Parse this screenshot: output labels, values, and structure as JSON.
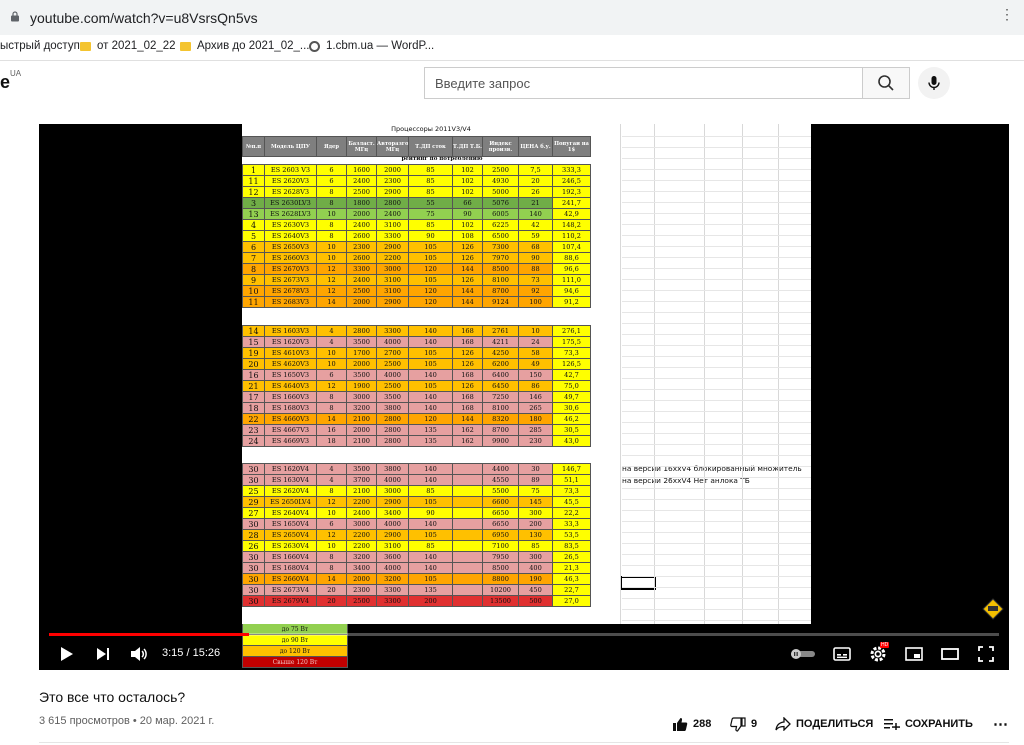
{
  "browser": {
    "url": "youtube.com/watch?v=u8VsrsQn5vs"
  },
  "bookmarks": [
    {
      "label": "ыстрый доступ",
      "icon": "none"
    },
    {
      "label": "от 2021_02_22",
      "icon": "folder-icon"
    },
    {
      "label": "Архив до 2021_02_...",
      "icon": "folder-icon"
    },
    {
      "label": "1.cbm.ua — WordP...",
      "icon": "globe-icon"
    }
  ],
  "header": {
    "logo_fragment": "e",
    "region": "UA",
    "search_placeholder": "Введите запрос"
  },
  "sheet": {
    "title": "Процессоры 2011V3/V4",
    "subhead": "рейтинг по потреблению",
    "headers": [
      "№п.п",
      "Модель ЦПУ",
      "Ядер",
      "Базласт. МГц",
      "Авторазгон МГц",
      "Т.ДП сток",
      "Т.ДП Т.Б.",
      "Индекс произв.",
      "ЦЕНА б.у.",
      "Попугаи на 1$"
    ],
    "rows_v3": [
      [
        "1",
        "ES 2603 V3",
        "6",
        "1600",
        "2000",
        "85",
        "102",
        "2500",
        "7,5",
        "333,3",
        "#ffff00"
      ],
      [
        "11",
        "ES 2620V3",
        "6",
        "2400",
        "2300",
        "85",
        "102",
        "4930",
        "20",
        "246,5",
        "#ffff00"
      ],
      [
        "12",
        "ES 2628V3",
        "8",
        "2500",
        "2900",
        "85",
        "102",
        "5000",
        "26",
        "192,3",
        "#ffff00"
      ],
      [
        "3",
        "ES 2630LV3",
        "8",
        "1800",
        "2800",
        "55",
        "66",
        "5076",
        "21",
        "241,7",
        "#70ad47"
      ],
      [
        "13",
        "ES 2628LV3",
        "10",
        "2000",
        "2400",
        "75",
        "90",
        "6005",
        "140",
        "42,9",
        "#92d050"
      ],
      [
        "4",
        "ES 2630V3",
        "8",
        "2400",
        "3100",
        "85",
        "102",
        "6225",
        "42",
        "148,2",
        "#ffff00"
      ],
      [
        "5",
        "ES 2640V3",
        "8",
        "2600",
        "3300",
        "90",
        "108",
        "6500",
        "59",
        "110,2",
        "#ffff00"
      ],
      [
        "6",
        "ES 2650V3",
        "10",
        "2300",
        "2900",
        "105",
        "126",
        "7300",
        "68",
        "107,4",
        "#ffc000"
      ],
      [
        "7",
        "ES 2660V3",
        "10",
        "2600",
        "2200",
        "105",
        "126",
        "7970",
        "90",
        "88,6",
        "#ffc000"
      ],
      [
        "8",
        "ES 2670V3",
        "12",
        "3300",
        "3000",
        "120",
        "144",
        "8500",
        "88",
        "96,6",
        "#ffa500"
      ],
      [
        "9",
        "ES 2673V3",
        "12",
        "2400",
        "3100",
        "105",
        "126",
        "8100",
        "73",
        "111,0",
        "#ffc000"
      ],
      [
        "10",
        "ES 2678V3",
        "12",
        "2500",
        "3100",
        "120",
        "144",
        "8700",
        "92",
        "94,6",
        "#ffa500"
      ],
      [
        "11",
        "ES 2683V3",
        "14",
        "2000",
        "2900",
        "120",
        "144",
        "9124",
        "100",
        "91,2",
        "#ffa500"
      ]
    ],
    "rows_v3_2": [
      [
        "14",
        "ES 1603V3",
        "4",
        "2800",
        "3300",
        "140",
        "168",
        "2761",
        "10",
        "276,1",
        "#ffc000"
      ],
      [
        "15",
        "ES 1620V3",
        "4",
        "3500",
        "4000",
        "140",
        "168",
        "4211",
        "24",
        "175,5",
        "#e6a0a0"
      ],
      [
        "19",
        "ES 4610V3",
        "10",
        "1700",
        "2700",
        "105",
        "126",
        "4250",
        "58",
        "73,3",
        "#ffc000"
      ],
      [
        "20",
        "ES 4620V3",
        "10",
        "2000",
        "2500",
        "105",
        "126",
        "6200",
        "49",
        "126,5",
        "#ffc000"
      ],
      [
        "16",
        "ES 1650V3",
        "6",
        "3500",
        "4000",
        "140",
        "168",
        "6400",
        "150",
        "42,7",
        "#e6a0a0"
      ],
      [
        "21",
        "ES 4640V3",
        "12",
        "1900",
        "2500",
        "105",
        "126",
        "6450",
        "86",
        "75,0",
        "#ffc000"
      ],
      [
        "17",
        "ES 1660V3",
        "8",
        "3000",
        "3500",
        "140",
        "168",
        "7250",
        "146",
        "49,7",
        "#e6a0a0"
      ],
      [
        "18",
        "ES 1680V3",
        "8",
        "3200",
        "3800",
        "140",
        "168",
        "8100",
        "265",
        "30,6",
        "#e6a0a0"
      ],
      [
        "22",
        "ES 4660V3",
        "14",
        "2100",
        "2800",
        "120",
        "144",
        "8320",
        "180",
        "46,2",
        "#ffa500"
      ],
      [
        "23",
        "ES 4667V3",
        "16",
        "2000",
        "2800",
        "135",
        "162",
        "8700",
        "285",
        "30,5",
        "#e6a0a0"
      ],
      [
        "24",
        "ES 4669V3",
        "18",
        "2100",
        "2800",
        "135",
        "162",
        "9900",
        "230",
        "43,0",
        "#e6a0a0"
      ]
    ],
    "rows_v4": [
      [
        "30",
        "ES 1620V4",
        "4",
        "3500",
        "3800",
        "140",
        "",
        "4400",
        "30",
        "146,7",
        "#e6a0a0"
      ],
      [
        "30",
        "ES 1630V4",
        "4",
        "3700",
        "4000",
        "140",
        "",
        "4550",
        "89",
        "51,1",
        "#e6a0a0"
      ],
      [
        "25",
        "ES 2620V4",
        "8",
        "2100",
        "3000",
        "85",
        "",
        "5500",
        "75",
        "73,3",
        "#ffff00"
      ],
      [
        "29",
        "ES 2650LV4",
        "12",
        "2200",
        "2900",
        "105",
        "",
        "6600",
        "145",
        "45,5",
        "#ffc000"
      ],
      [
        "27",
        "ES 2640V4",
        "10",
        "2400",
        "3400",
        "90",
        "",
        "6650",
        "300",
        "22,2",
        "#ffff00"
      ],
      [
        "30",
        "ES 1650V4",
        "6",
        "3000",
        "4000",
        "140",
        "",
        "6650",
        "200",
        "33,3",
        "#e6a0a0"
      ],
      [
        "28",
        "ES 2650V4",
        "12",
        "2200",
        "2900",
        "105",
        "",
        "6950",
        "130",
        "53,5",
        "#ffc000"
      ],
      [
        "26",
        "ES 2630V4",
        "10",
        "2200",
        "3100",
        "85",
        "",
        "7100",
        "85",
        "83,5",
        "#ffff00"
      ],
      [
        "30",
        "ES 1660V4",
        "8",
        "3200",
        "3600",
        "140",
        "",
        "7950",
        "300",
        "26,5",
        "#e6a0a0"
      ],
      [
        "30",
        "ES 1680V4",
        "8",
        "3400",
        "4000",
        "140",
        "",
        "8500",
        "400",
        "21,3",
        "#e6a0a0"
      ],
      [
        "30",
        "ES 2660V4",
        "14",
        "2000",
        "3200",
        "105",
        "",
        "8800",
        "190",
        "46,3",
        "#ffa500"
      ],
      [
        "30",
        "ES 2673V4",
        "20",
        "2300",
        "3300",
        "135",
        "",
        "10200",
        "450",
        "22,7",
        "#e6a0a0"
      ],
      [
        "30",
        "ES 2679V4",
        "20",
        "2500",
        "3300",
        "200",
        "",
        "13500",
        "500",
        "27,0",
        "#e03030"
      ]
    ],
    "notes": [
      "на версии 16xxV4 блокированный множитель",
      "на версии 26xxV4  Нет анлока ТБ"
    ],
    "legend": [
      {
        "label": "до 75 Вт",
        "color": "#92d050"
      },
      {
        "label": "до 90 Вт",
        "color": "#ffff00"
      },
      {
        "label": "до 120 Вт",
        "color": "#ffc000"
      },
      {
        "label": "Свыше 120 Вт",
        "color": "#c00000"
      }
    ]
  },
  "player": {
    "current_time": "3:15",
    "duration": "15:26",
    "time_display": "3:15 / 15:26",
    "progress": 0.21,
    "hd_badge": "HD"
  },
  "video": {
    "title": "Это все что осталось?",
    "meta": "3 615 просмотров • 20 мар. 2021 г.",
    "likes": "288",
    "dislikes": "9",
    "share_label": "ПОДЕЛИТЬСЯ",
    "save_label": "СОХРАНИТЬ"
  }
}
